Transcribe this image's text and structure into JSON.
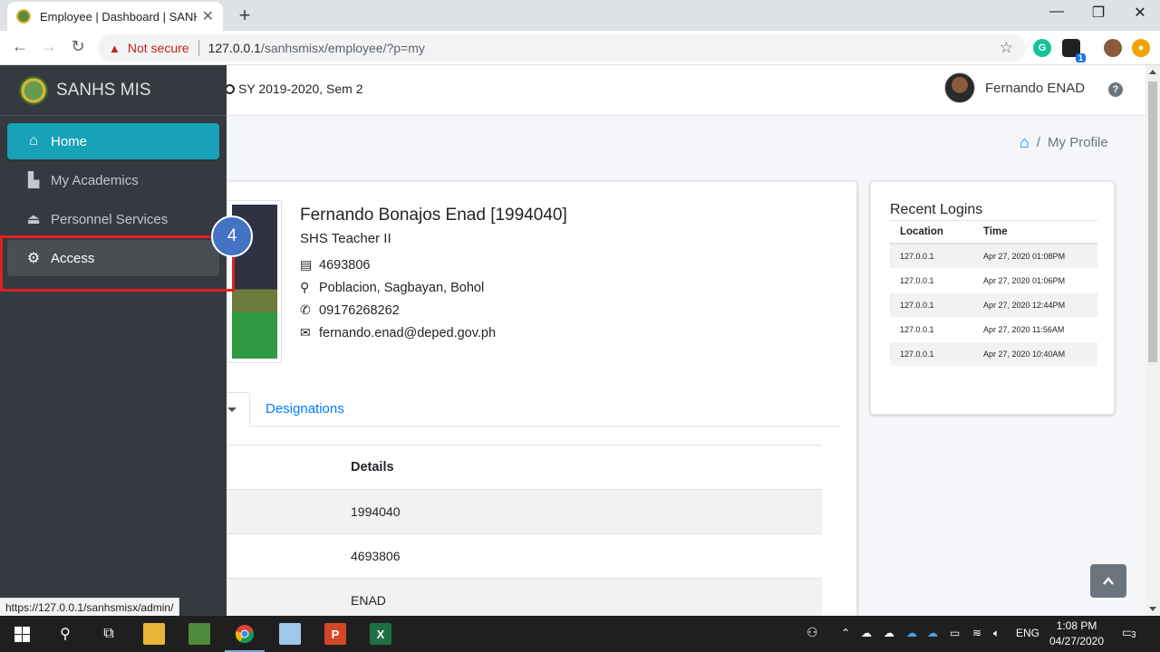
{
  "browser": {
    "tab_title": "Employee | Dashboard | SANHS MIS",
    "security_label": "Not secure",
    "url_host": "127.0.0.1",
    "url_path": "/sanhsmisx/employee/?p=my",
    "status_url": "https://127.0.0.1/sanhsmisx/admin/",
    "extension_badge": "1"
  },
  "sidebar": {
    "brand": "SANHS MIS",
    "items": [
      {
        "label": "Home",
        "icon": "home-icon"
      },
      {
        "label": "My Academics",
        "icon": "user-tie-icon"
      },
      {
        "label": "Personnel Services",
        "icon": "concierge-bell-icon"
      },
      {
        "label": "Access",
        "icon": "cogs-icon"
      }
    ],
    "callout_number": "4",
    "colors": {
      "bg": "#343a40",
      "active": "#17a2b8",
      "highlight": "#e02020",
      "callout": "#4472c4"
    }
  },
  "topbar": {
    "school_year": "SY 2019-2020, Sem 2",
    "user_name": "Fernando ENAD"
  },
  "breadcrumb": {
    "current": "My Profile"
  },
  "profile": {
    "name": "Fernando Bonajos Enad [1994040]",
    "position": "SHS Teacher II",
    "id_number": "4693806",
    "address": "Poblacion, Sagbayan, Bohol",
    "phone": "09176268262",
    "email": "fernando.enad@deped.gov.ph",
    "tab_designations": "Designations",
    "table": {
      "header": "Details",
      "rows": [
        "1994040",
        "4693806",
        "ENAD"
      ]
    }
  },
  "logins": {
    "title": "Recent Logins",
    "col_location": "Location",
    "col_time": "Time",
    "rows": [
      {
        "location": "127.0.0.1",
        "time": "Apr 27, 2020 01:08PM"
      },
      {
        "location": "127.0.0.1",
        "time": "Apr 27, 2020 01:06PM"
      },
      {
        "location": "127.0.0.1",
        "time": "Apr 27, 2020 12:44PM"
      },
      {
        "location": "127.0.0.1",
        "time": "Apr 27, 2020 11:56AM"
      },
      {
        "location": "127.0.0.1",
        "time": "Apr 27, 2020 10:40AM"
      }
    ]
  },
  "taskbar": {
    "lang": "ENG",
    "time": "1:08 PM",
    "date": "04/27/2020",
    "notifications": "3"
  }
}
